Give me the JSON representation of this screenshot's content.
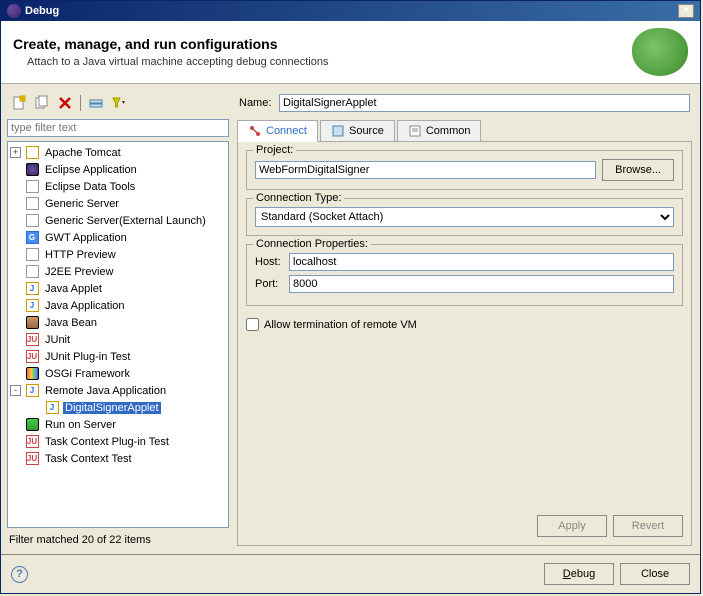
{
  "title": "Debug",
  "header": {
    "title": "Create, manage, and run configurations",
    "subtitle": "Attach to a Java virtual machine accepting debug connections"
  },
  "filter": {
    "placeholder": "type filter text"
  },
  "tree": {
    "items": [
      {
        "label": "Apache Tomcat",
        "expander": "+",
        "iconBg": "#fff",
        "iconBorder": "#c90"
      },
      {
        "label": "Eclipse Application",
        "expander": "",
        "iconBg": "radial-gradient(circle,#6b4fa5,#3b2466)"
      },
      {
        "label": "Eclipse Data Tools",
        "expander": "",
        "iconBg": "#fff",
        "iconBorder": "#999"
      },
      {
        "label": "Generic Server",
        "expander": "",
        "iconBg": "#fff",
        "iconBorder": "#999"
      },
      {
        "label": "Generic Server(External Launch)",
        "expander": "",
        "iconBg": "#fff",
        "iconBorder": "#999"
      },
      {
        "label": "GWT Application",
        "expander": "",
        "iconBg": "#4a8cf0",
        "iconBorder": "#2a6cd0",
        "glyph": "G",
        "glyphColor": "#fff"
      },
      {
        "label": "HTTP Preview",
        "expander": "",
        "iconBg": "#fff",
        "iconBorder": "#999"
      },
      {
        "label": "J2EE Preview",
        "expander": "",
        "iconBg": "#fff",
        "iconBorder": "#999"
      },
      {
        "label": "Java Applet",
        "expander": "",
        "iconBg": "#fff",
        "iconBorder": "#c90",
        "glyph": "J",
        "glyphColor": "#2a6cd0"
      },
      {
        "label": "Java Application",
        "expander": "",
        "iconBg": "#fff",
        "iconBorder": "#c90",
        "glyph": "J",
        "glyphColor": "#2a6cd0"
      },
      {
        "label": "Java Bean",
        "expander": "",
        "iconBg": "linear-gradient(#c96,#964)"
      },
      {
        "label": "JUnit",
        "expander": "",
        "iconBg": "#fff",
        "iconBorder": "#c44",
        "glyph": "JU",
        "glyphColor": "#c44"
      },
      {
        "label": "JUnit Plug-in Test",
        "expander": "",
        "iconBg": "#fff",
        "iconBorder": "#c44",
        "glyph": "JU",
        "glyphColor": "#c44"
      },
      {
        "label": "OSGi Framework",
        "expander": "",
        "iconBg": "linear-gradient(90deg,#e74,#f94,#fc4,#7c4,#4af,#74c)"
      },
      {
        "label": "Remote Java Application",
        "expander": "-",
        "iconBg": "#fff",
        "iconBorder": "#c90",
        "glyph": "J",
        "glyphColor": "#2a6cd0",
        "children": true
      },
      {
        "label": "DigitalSignerApplet",
        "child": true,
        "selected": true,
        "iconBg": "#fff",
        "iconBorder": "#c90",
        "glyph": "J",
        "glyphColor": "#2a6cd0"
      },
      {
        "label": "Run on Server",
        "expander": "",
        "iconBg": "linear-gradient(#4c4,#393)"
      },
      {
        "label": "Task Context Plug-in Test",
        "expander": "",
        "iconBg": "#fff",
        "iconBorder": "#c44",
        "glyph": "JU",
        "glyphColor": "#c44"
      },
      {
        "label": "Task Context Test",
        "expander": "",
        "iconBg": "#fff",
        "iconBorder": "#c44",
        "glyph": "JU",
        "glyphColor": "#c44"
      }
    ]
  },
  "tree_footer": "Filter matched 20 of 22 items",
  "form": {
    "name_label": "Name:",
    "name_value": "DigitalSignerApplet",
    "tabs": [
      {
        "label": "Connect",
        "active": true
      },
      {
        "label": "Source"
      },
      {
        "label": "Common"
      }
    ],
    "project": {
      "title": "Project:",
      "value": "WebFormDigitalSigner",
      "browse": "Browse..."
    },
    "conn_type": {
      "title": "Connection Type:",
      "value": "Standard (Socket Attach)"
    },
    "conn_props": {
      "title": "Connection Properties:",
      "host_label": "Host:",
      "host_value": "localhost",
      "port_label": "Port:",
      "port_value": "8000"
    },
    "allow_term": "Allow termination of remote VM",
    "apply": "Apply",
    "revert": "Revert"
  },
  "footer": {
    "debug": "Debug",
    "close": "Close"
  }
}
